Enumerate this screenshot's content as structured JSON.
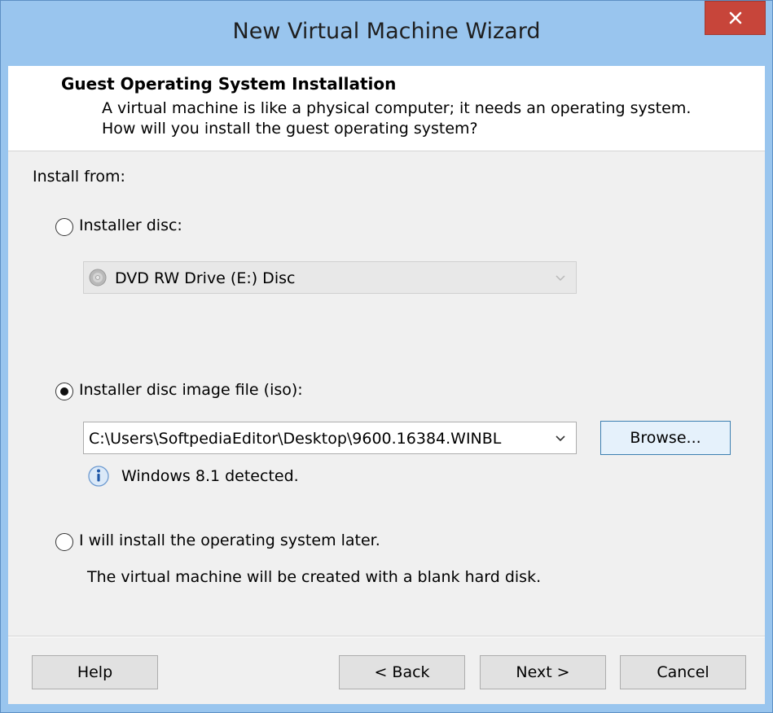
{
  "window": {
    "title": "New Virtual Machine Wizard",
    "close_label": "×"
  },
  "header": {
    "title": "Guest Operating System Installation",
    "description": "A virtual machine is like a physical computer; it needs an operating system. How will you install the guest operating system?"
  },
  "install_from_label": "Install from:",
  "options": {
    "disc": {
      "label": "Installer disc:",
      "selected": false,
      "drive_value": "DVD RW Drive (E:) Disc"
    },
    "iso": {
      "label": "Installer disc image file (iso):",
      "selected": true,
      "path_value": "C:\\Users\\SoftpediaEditor\\Desktop\\9600.16384.WINBL",
      "browse_label": "Browse...",
      "detected_text": "Windows 8.1 detected."
    },
    "later": {
      "label": "I will install the operating system later.",
      "selected": false,
      "note": "The virtual machine will be created with a blank hard disk."
    }
  },
  "footer": {
    "help_label": "Help",
    "back_label": "< Back",
    "next_label": "Next >",
    "cancel_label": "Cancel"
  },
  "colors": {
    "titlebar": "#99c5ee",
    "close_button": "#c7453a",
    "dialog_bg": "#f0f0f0",
    "header_bg": "#ffffff"
  },
  "icons": {
    "disc": "cd-disc-icon",
    "info": "info-icon",
    "dropdown": "chevron-down-icon"
  }
}
